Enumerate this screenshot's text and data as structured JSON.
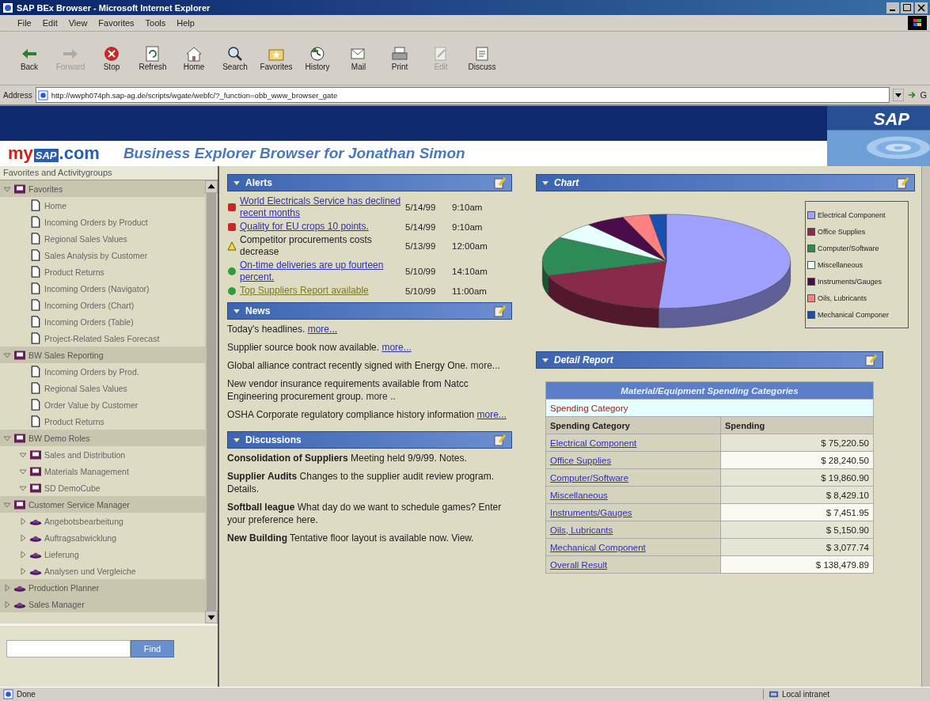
{
  "window": {
    "title": "SAP BEx Browser - Microsoft Internet Explorer"
  },
  "menu": [
    "File",
    "Edit",
    "View",
    "Favorites",
    "Tools",
    "Help"
  ],
  "toolbar": [
    {
      "kind": "back",
      "label": "Back",
      "disabled": false
    },
    {
      "kind": "forward",
      "label": "Forward",
      "disabled": true
    },
    {
      "kind": "stop",
      "label": "Stop",
      "disabled": false
    },
    {
      "kind": "refresh",
      "label": "Refresh",
      "disabled": false
    },
    {
      "kind": "home",
      "label": "Home",
      "disabled": false
    },
    {
      "kind": "search",
      "label": "Search",
      "disabled": false
    },
    {
      "kind": "favorites",
      "label": "Favorites",
      "disabled": false
    },
    {
      "kind": "history",
      "label": "History",
      "disabled": false
    },
    {
      "kind": "mail",
      "label": "Mail",
      "disabled": false
    },
    {
      "kind": "print",
      "label": "Print",
      "disabled": false
    },
    {
      "kind": "edit",
      "label": "Edit",
      "disabled": true
    },
    {
      "kind": "discuss",
      "label": "Discuss",
      "disabled": false
    }
  ],
  "address": {
    "label": "Address",
    "value": "http://wwph074ph.sap-ag.de/scripts/wgate/webfc/?_function=obb_www_browser_gate",
    "go": "G"
  },
  "portal": {
    "logo_my": "my",
    "logo_sap": "SAP",
    "logo_com": ".com",
    "title": "Business Explorer Browser for Jonathan Simon",
    "brand": "SAP"
  },
  "sidebar": {
    "title": "Favorites and Activitygroups",
    "tree": [
      {
        "kind": "group",
        "label": "Favorites",
        "expanded": true,
        "children": [
          {
            "kind": "page",
            "label": "Home"
          },
          {
            "kind": "page",
            "label": "Incoming Orders by Product"
          },
          {
            "kind": "page",
            "label": "Regional Sales Values"
          },
          {
            "kind": "page",
            "label": "Sales Analysis by Customer"
          },
          {
            "kind": "page",
            "label": "Product Returns"
          },
          {
            "kind": "page",
            "label": "Incoming Orders (Navigator)"
          },
          {
            "kind": "page",
            "label": "Incoming Orders (Chart)"
          },
          {
            "kind": "page",
            "label": "Incoming Orders (Table)"
          },
          {
            "kind": "page",
            "label": "Project-Related Sales Forecast"
          }
        ]
      },
      {
        "kind": "group",
        "label": "BW Sales Reporting",
        "expanded": true,
        "children": [
          {
            "kind": "page",
            "label": "Incoming Orders by Prod."
          },
          {
            "kind": "page",
            "label": "Regional Sales Values"
          },
          {
            "kind": "page",
            "label": "Order Value by Customer"
          },
          {
            "kind": "page",
            "label": "Product Returns"
          }
        ]
      },
      {
        "kind": "group",
        "label": "BW Demo Roles",
        "expanded": true,
        "children": [
          {
            "kind": "group",
            "label": "Sales and Distribution",
            "expanded": true
          },
          {
            "kind": "group",
            "label": "Materials Management",
            "expanded": true
          },
          {
            "kind": "group",
            "label": "SD DemoCube",
            "expanded": true
          }
        ]
      },
      {
        "kind": "group",
        "label": "Customer Service Manager",
        "expanded": true,
        "children": [
          {
            "kind": "role",
            "label": "Angebotsbearbeitung",
            "expanded": false
          },
          {
            "kind": "role",
            "label": "Auftragsabwicklung",
            "expanded": false
          },
          {
            "kind": "role",
            "label": "Lieferung",
            "expanded": false
          },
          {
            "kind": "role",
            "label": "Analysen und Vergleiche",
            "expanded": false
          }
        ]
      },
      {
        "kind": "role",
        "label": "Production Planner",
        "expanded": false
      },
      {
        "kind": "role",
        "label": "Sales Manager",
        "expanded": false
      }
    ],
    "find": "Find"
  },
  "alerts": {
    "title": "Alerts",
    "items": [
      {
        "kind": "critical",
        "text": "World Electricals Service has declined recent months",
        "link": true,
        "date": "5/14/99",
        "time": "9:10am"
      },
      {
        "kind": "critical",
        "text": "Quality for EU crops 10 points.",
        "link": true,
        "date": "5/14/99",
        "time": "9:10am"
      },
      {
        "kind": "warning",
        "text": "Competitor procurements costs decrease",
        "link": false,
        "date": "5/13/99",
        "time": "12:00am"
      },
      {
        "kind": "ok",
        "text": "On-time deliveries are up fourteen percent.",
        "link": true,
        "date": "5/10/99",
        "time": "14:10am"
      },
      {
        "kind": "ok",
        "text": "Top Suppliers Report available",
        "link": true,
        "date": "5/10/99",
        "time": "11:00am"
      }
    ]
  },
  "news": {
    "title": "News",
    "items": [
      {
        "text": "Today's headlines.",
        "more": "more...",
        "link": true
      },
      {
        "text": "Supplier source book now available.",
        "more": "more...",
        "link": true
      },
      {
        "text": "Global alliance contract recently signed with Energy One.",
        "more": "more...",
        "link": false
      },
      {
        "text": "New vendor insurance requirements available from Natcc Engineering procurement group.",
        "more": "more ..",
        "link": false
      },
      {
        "text": "OSHA Corporate regulatory compliance history information",
        "more": "more...",
        "link": true
      }
    ]
  },
  "discussions": {
    "title": "Discussions",
    "items": [
      "**Consolidation of Suppliers** Meeting held 9/9/99. Notes.",
      "**Supplier Audits** Changes to the supplier audit review program. Details.",
      "**Softball league** What day do we want to schedule games? Enter your preference here.",
      "**New Building** Tentative floor layout is available now. View."
    ]
  },
  "chart": {
    "title": "Chart",
    "legend": [
      {
        "label": "Electrical Component",
        "color": "#a0a0ff"
      },
      {
        "label": "Office Supplies",
        "color": "#8a2a4a"
      },
      {
        "label": "Computer/Software",
        "color": "#2e8b57"
      },
      {
        "label": "Miscellaneous",
        "color": "#e6ffff"
      },
      {
        "label": "Instruments/Gauges",
        "color": "#4a0c4a"
      },
      {
        "label": "Oils, Lubricants",
        "color": "#ff8080"
      },
      {
        "label": "Mechanical Componer",
        "color": "#1850b0"
      }
    ]
  },
  "report": {
    "title": "Detail Report",
    "table_title": "Material/Equipment Spending Categories",
    "filter": "Spending Category",
    "columns": [
      "Spending Category",
      "Spending"
    ],
    "rows": [
      {
        "category": "Electrical Component",
        "amount": "$ 75,220.50"
      },
      {
        "category": "Office Supplies",
        "amount": "$ 28,240.50"
      },
      {
        "category": "Computer/Software",
        "amount": "$ 19,860.90"
      },
      {
        "category": "Miscellaneous",
        "amount": "$ 8,429.10"
      },
      {
        "category": "Instruments/Gauges",
        "amount": "$ 7,451.95"
      },
      {
        "category": "Oils, Lubricants",
        "amount": "$ 5,150.90"
      },
      {
        "category": "Mechanical Component",
        "amount": "$ 3,077.74"
      },
      {
        "category": "Overall Result",
        "amount": "$ 138,479.89"
      }
    ]
  },
  "status_bar": {
    "text": "Done",
    "zone": "Local intranet"
  }
}
